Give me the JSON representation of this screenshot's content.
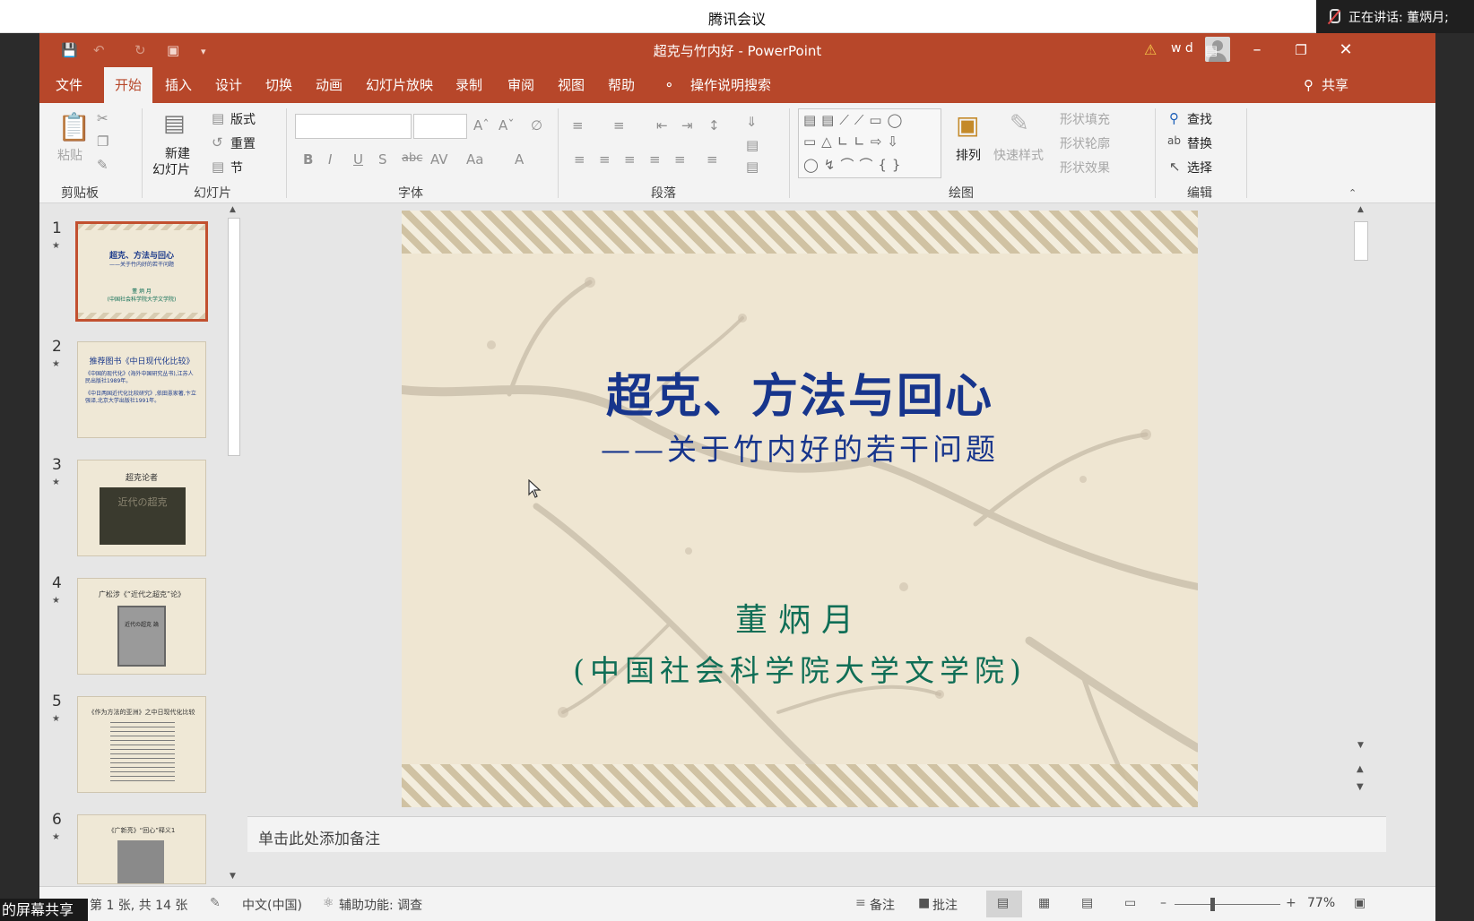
{
  "meeting": {
    "app_title": "腾讯会议",
    "speaking": "正在讲话: 董炳月;"
  },
  "window": {
    "doc_title": "超克与竹内好 - PowerPoint",
    "user": "w d"
  },
  "tabs": [
    "文件",
    "开始",
    "插入",
    "设计",
    "切换",
    "动画",
    "幻灯片放映",
    "录制",
    "审阅",
    "视图",
    "帮助"
  ],
  "tell_me": "操作说明搜索",
  "share_btn": "共享",
  "ribbon": {
    "clipboard": {
      "paste": "粘贴",
      "label": "剪贴板"
    },
    "slides": {
      "new_slide_1": "新建",
      "new_slide_2": "幻灯片",
      "layout": "版式",
      "reset": "重置",
      "section": "节",
      "label": "幻灯片"
    },
    "font": {
      "label": "字体"
    },
    "paragraph": {
      "label": "段落"
    },
    "drawing": {
      "arrange": "排列",
      "quick_styles": "快速样式",
      "shape_fill": "形状填充",
      "shape_outline": "形状轮廓",
      "shape_effects": "形状效果",
      "label": "绘图"
    },
    "editing": {
      "find": "查找",
      "replace": "替换",
      "select": "选择",
      "label": "编辑"
    }
  },
  "thumbnails": [
    {
      "num": "1",
      "title": "超克、方法与回心",
      "lines": [
        "——关于竹内好的若干问题",
        "董 炳 月",
        "(中国社会科学院大学文学院)"
      ]
    },
    {
      "num": "2",
      "title": "推荐图书《中日现代化比较》",
      "lines": [
        "《中国的现代化》(海外中国研究丛书),江苏人民出版社1989年。",
        "《中日两国近代化比较研究》,依田憙家著,卞立强译,北京大学出版社1991年。"
      ]
    },
    {
      "num": "3",
      "title": "超克论者",
      "lines": [
        "近代の超克"
      ]
    },
    {
      "num": "4",
      "title": "广松涉《“近代之超克”论》",
      "lines": [
        "近代の超克 論"
      ]
    },
    {
      "num": "5",
      "title": "《作为方法的亚洲》之中日现代化比较",
      "lines": []
    },
    {
      "num": "6",
      "title": "《广新亮》“回心”释义1",
      "lines": []
    }
  ],
  "slide": {
    "title": "超克、方法与回心",
    "subtitle": "——关于竹内好的若干问题",
    "author": "董炳月",
    "affiliation": "(中国社会科学院大学文学院)"
  },
  "notes_placeholder": "单击此处添加备注",
  "status": {
    "slide_count": "第 1 张, 共 14 张",
    "language": "中文(中国)",
    "accessibility": "辅助功能: 调查",
    "notes": "备注",
    "comments": "批注",
    "zoom": "77%"
  },
  "share_overlay": "的屏幕共享"
}
